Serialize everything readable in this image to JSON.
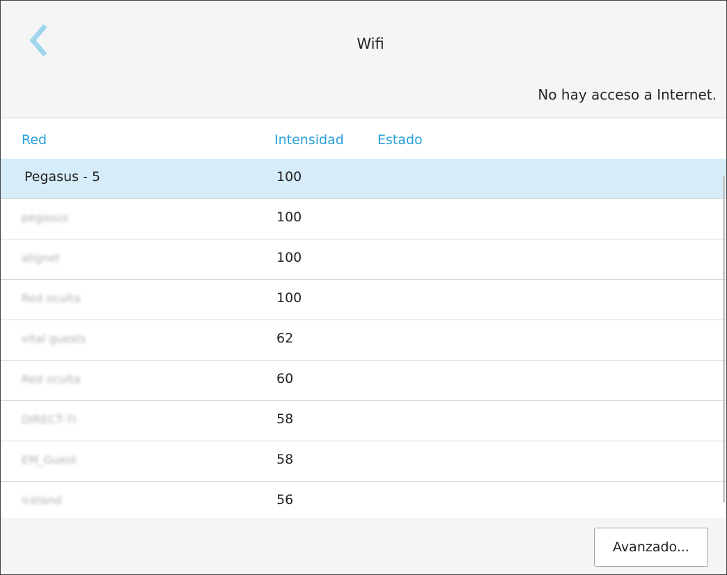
{
  "header": {
    "back_icon": "chevron-left-icon",
    "title": "Wifi",
    "status": "No hay acceso a Internet."
  },
  "table": {
    "columns": [
      "Red",
      "Intensidad",
      "Estado"
    ],
    "rows": [
      {
        "name": "Pegasus - 5",
        "strength": "100",
        "status": "",
        "selected": true,
        "blurred": false
      },
      {
        "name": "pegasus",
        "strength": "100",
        "status": "",
        "selected": false,
        "blurred": true
      },
      {
        "name": "alignet",
        "strength": "100",
        "status": "",
        "selected": false,
        "blurred": true
      },
      {
        "name": "Red oculta",
        "strength": "100",
        "status": "",
        "selected": false,
        "blurred": true
      },
      {
        "name": "vital guests",
        "strength": "62",
        "status": "",
        "selected": false,
        "blurred": true
      },
      {
        "name": "Red oculta",
        "strength": "60",
        "status": "",
        "selected": false,
        "blurred": true
      },
      {
        "name": "DIRECT-7I",
        "strength": "58",
        "status": "",
        "selected": false,
        "blurred": true
      },
      {
        "name": "EM_Guest",
        "strength": "58",
        "status": "",
        "selected": false,
        "blurred": true
      },
      {
        "name": "iceland",
        "strength": "56",
        "status": "",
        "selected": false,
        "blurred": true
      }
    ]
  },
  "footer": {
    "advanced_label": "Avanzado..."
  },
  "colors": {
    "accent": "#2a9fd8",
    "back_icon": "#9fd6ec",
    "selected_row": "#d6ecf8",
    "panel_bg": "#f5f5f5"
  }
}
